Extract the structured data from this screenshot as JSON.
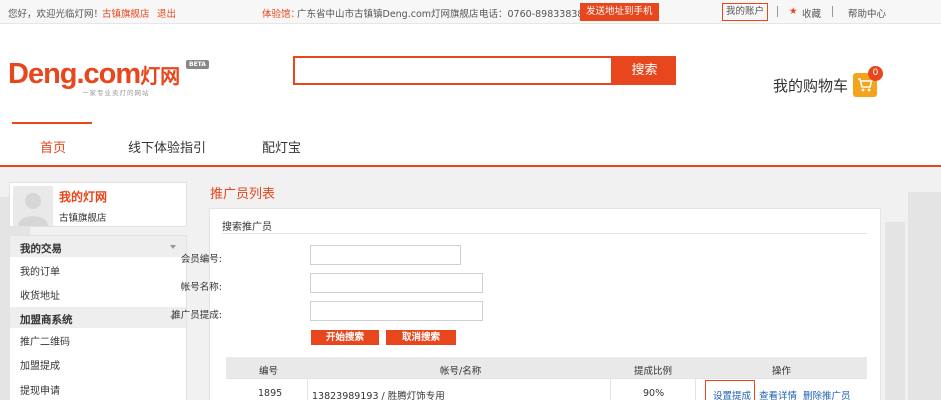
{
  "topbar": {
    "greeting": "您好，欢迎光临灯网！",
    "store_link": "古镇旗舰店",
    "logout": "退出",
    "experience_label": "体验馆：",
    "experience_address": "广东省中山市古镇镇Deng.com灯网旗舰店",
    "phone": "电话：0760-89833838",
    "send_button": "发送地址到手机",
    "my_account": "我的账户",
    "favorites": "收藏",
    "help": "帮助中心"
  },
  "header": {
    "logo_text": "Deng.com",
    "logo_cn": "灯网",
    "logo_badge": "BETA",
    "slogan": "一家专业卖灯的网站",
    "search_placeholder": "",
    "search_button": "搜索",
    "cart_label": "我的购物车",
    "cart_count": "0"
  },
  "nav": {
    "items": [
      {
        "label": "首页",
        "active": true
      },
      {
        "label": "线下体验指引",
        "active": false
      },
      {
        "label": "配灯宝",
        "active": false
      }
    ]
  },
  "sidebar": {
    "profile_title": "我的灯网",
    "profile_sub": "古镇旗舰店",
    "sections": [
      {
        "title": "我的交易",
        "items": [
          "我的订单",
          "收货地址"
        ]
      },
      {
        "title": "加盟商系统",
        "items": [
          "推广二维码",
          "加盟提成",
          "提现申请"
        ]
      }
    ]
  },
  "main": {
    "title": "推广员列表",
    "panel_title": "搜索推广员",
    "form": {
      "member_no_label": "会员编号:",
      "account_label": "帐号名称:",
      "commission_label": "推广员提成:",
      "member_no_value": "",
      "account_value": "",
      "commission_value": "",
      "search_button": "开始搜索",
      "cancel_button": "取消搜索"
    },
    "table": {
      "headers": [
        "编号",
        "帐号/名称",
        "提成比例",
        "操作"
      ],
      "rows": [
        {
          "id": "1895",
          "account": "13823989193 / 胜腾灯饰专用",
          "ratio": "90%",
          "ops": [
            "设置提成",
            "查看详情",
            "删除推广员"
          ]
        }
      ]
    }
  },
  "colors": {
    "accent": "#e8461c",
    "cart": "#f6a31c",
    "link": "#1e5fb3"
  }
}
